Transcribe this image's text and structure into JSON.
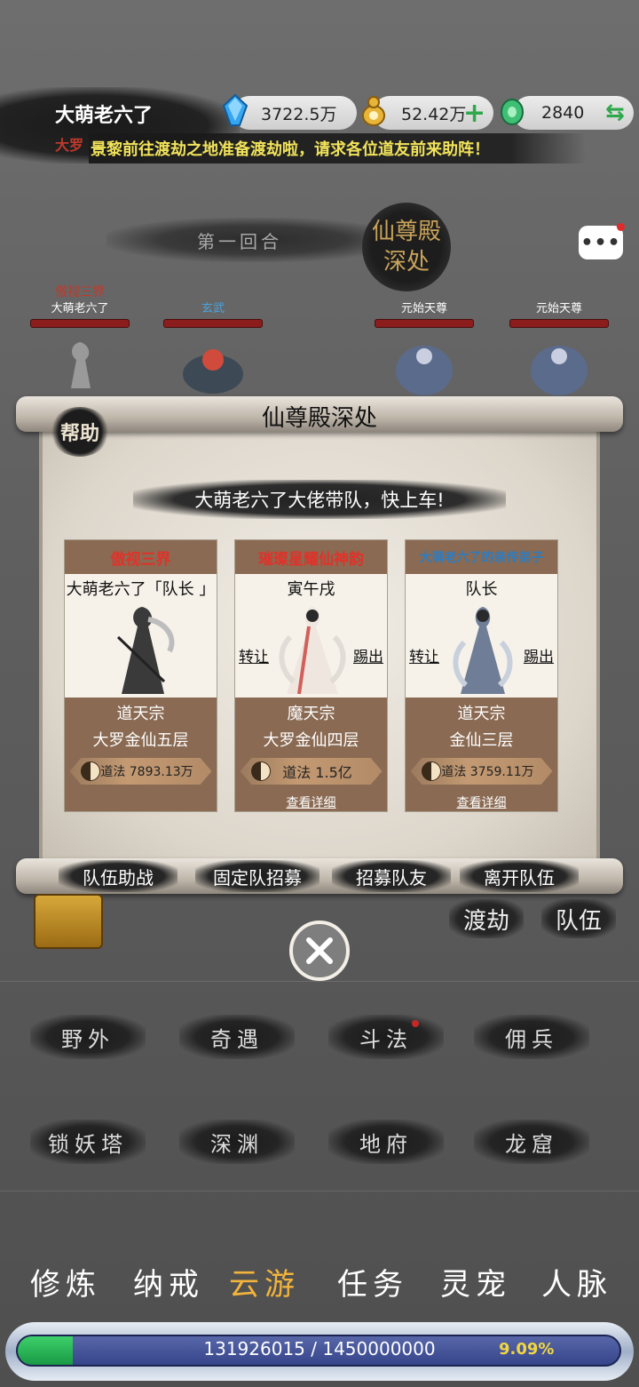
{
  "player": {
    "name": "大萌老六了",
    "rank": "大罗"
  },
  "resources": [
    {
      "icon": "blue-crystal-icon",
      "value": "3722.5万"
    },
    {
      "icon": "gold-gourd-icon",
      "value": "52.42万",
      "action": "+"
    },
    {
      "icon": "jade-icon",
      "value": "2840",
      "action": "⇆"
    }
  ],
  "notice": "景黎前往渡劫之地准备渡劫啦，请求各位道友前来助阵！",
  "battle": {
    "round": "第一回合",
    "stage_seal": [
      "仙尊殿",
      "深处"
    ],
    "chat_label": "•••",
    "units": [
      {
        "title": "傲视三界",
        "name": "大萌老六了"
      },
      {
        "title": "",
        "name": "玄武"
      },
      {
        "title": "",
        "name": "元始天尊"
      },
      {
        "title": "",
        "name": "元始天尊"
      }
    ]
  },
  "modal": {
    "title": "仙尊殿深处",
    "help_label": "帮助",
    "banner": "大萌老六了大佬带队，快上车!",
    "cards": [
      {
        "title": "傲视三界",
        "title_color": "#e0322a",
        "subtitle": "大萌老六了「队长 」",
        "sect": "道天宗",
        "realm": "大罗金仙五层",
        "power": "道法 7893.13万"
      },
      {
        "title": "璀璨星耀仙神韵",
        "title_color": "#e0322a",
        "subtitle": "寅午戌",
        "transfer": "转让",
        "kick": "踢出",
        "sect": "魔天宗",
        "realm": "大罗金仙四层",
        "power": "道法 1.5亿",
        "detail": "查看详细"
      },
      {
        "title": "大萌老六了的亲传弟子",
        "title_color": "#2a7dc4",
        "subtitle": "队长",
        "transfer": "转让",
        "kick": "踢出",
        "sect": "道天宗",
        "realm": "金仙三层",
        "power": "道法 3759.11万",
        "detail": "查看详细"
      }
    ],
    "buttons": [
      "队伍助战",
      "固定队招募",
      "招募队友",
      "离开队伍"
    ]
  },
  "side_buttons": [
    "渡劫",
    "队伍"
  ],
  "map_buttons": [
    "野外",
    "奇遇",
    "斗法",
    "佣兵",
    "锁妖塔",
    "深渊",
    "地府",
    "龙窟"
  ],
  "nav": [
    "修炼",
    "纳戒",
    "云游",
    "任务",
    "灵宠",
    "人脉"
  ],
  "nav_active": "云游",
  "xp": {
    "text": "131926015 / 1450000000",
    "percent": "9.09%",
    "fraction": 0.0909
  }
}
